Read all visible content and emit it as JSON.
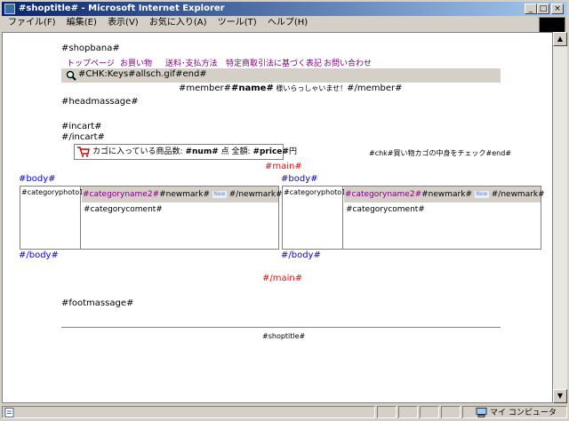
{
  "window": {
    "title": "#shoptitle# - Microsoft Internet Explorer",
    "minimize": "_",
    "maximize": "□",
    "close": "×"
  },
  "menu": [
    "ファイル(F)",
    "編集(E)",
    "表示(V)",
    "お気に入り(A)",
    "ツール(T)",
    "ヘルプ(H)"
  ],
  "page": {
    "shopbana": "#shopbana#",
    "nav": [
      "トップページ",
      "お買い物",
      "送料･支払方法",
      "特定商取引法に基づく表記",
      "お問い合わせ"
    ],
    "search_text": "#CHK:Keys#allsch.gif#end#",
    "member_prefix": "#member#",
    "member_name": "#name#",
    "member_greet": " 様いらっしゃいませ！",
    "member_suffix": "#/member#",
    "headmassage": "#headmassage#",
    "incart_open": "#incart#",
    "incart_close": "#/incart#",
    "cart_label": "カゴに入っている商品数:",
    "cart_num": "#num#",
    "cart_unit": "点",
    "cart_total_label": "全額:",
    "cart_price": "#price#",
    "cart_yen": "円",
    "chk_text": "#chk#買い物カゴの中身をチェック#end#",
    "main_open": "#main#",
    "main_close": "#/main#",
    "body_open": "#body#",
    "body_close": "#/body#",
    "category_photo": "#categoryphoto1#",
    "category_name": "#categoryname2#",
    "newmark_open": "#newmark#",
    "new_icon": "New",
    "newmark_close": "#/newmark#",
    "category_comment": "#categorycoment#",
    "footmassage": "#footmassage#",
    "footer_title": "#shoptitle#"
  },
  "status": {
    "zone": "マイ コンピュータ"
  }
}
